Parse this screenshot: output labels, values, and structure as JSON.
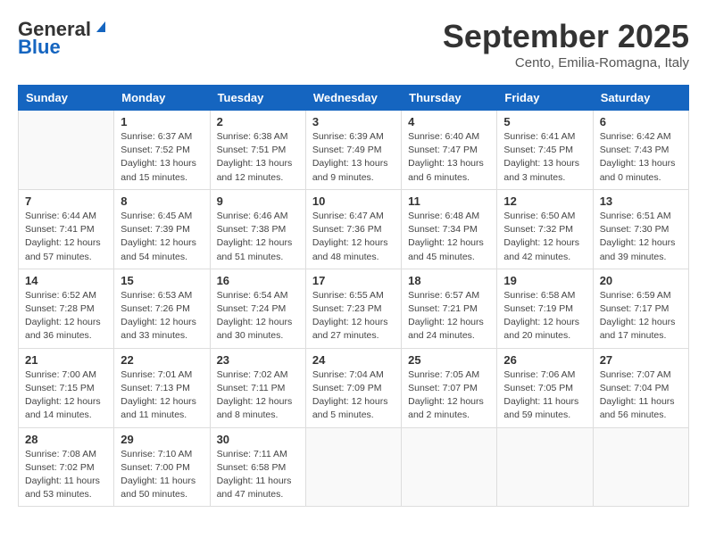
{
  "header": {
    "logo_general": "General",
    "logo_blue": "Blue",
    "month_title": "September 2025",
    "subtitle": "Cento, Emilia-Romagna, Italy"
  },
  "weekdays": [
    "Sunday",
    "Monday",
    "Tuesday",
    "Wednesday",
    "Thursday",
    "Friday",
    "Saturday"
  ],
  "weeks": [
    [
      {
        "day": "",
        "sunrise": "",
        "sunset": "",
        "daylight": ""
      },
      {
        "day": "1",
        "sunrise": "Sunrise: 6:37 AM",
        "sunset": "Sunset: 7:52 PM",
        "daylight": "Daylight: 13 hours and 15 minutes."
      },
      {
        "day": "2",
        "sunrise": "Sunrise: 6:38 AM",
        "sunset": "Sunset: 7:51 PM",
        "daylight": "Daylight: 13 hours and 12 minutes."
      },
      {
        "day": "3",
        "sunrise": "Sunrise: 6:39 AM",
        "sunset": "Sunset: 7:49 PM",
        "daylight": "Daylight: 13 hours and 9 minutes."
      },
      {
        "day": "4",
        "sunrise": "Sunrise: 6:40 AM",
        "sunset": "Sunset: 7:47 PM",
        "daylight": "Daylight: 13 hours and 6 minutes."
      },
      {
        "day": "5",
        "sunrise": "Sunrise: 6:41 AM",
        "sunset": "Sunset: 7:45 PM",
        "daylight": "Daylight: 13 hours and 3 minutes."
      },
      {
        "day": "6",
        "sunrise": "Sunrise: 6:42 AM",
        "sunset": "Sunset: 7:43 PM",
        "daylight": "Daylight: 13 hours and 0 minutes."
      }
    ],
    [
      {
        "day": "7",
        "sunrise": "Sunrise: 6:44 AM",
        "sunset": "Sunset: 7:41 PM",
        "daylight": "Daylight: 12 hours and 57 minutes."
      },
      {
        "day": "8",
        "sunrise": "Sunrise: 6:45 AM",
        "sunset": "Sunset: 7:39 PM",
        "daylight": "Daylight: 12 hours and 54 minutes."
      },
      {
        "day": "9",
        "sunrise": "Sunrise: 6:46 AM",
        "sunset": "Sunset: 7:38 PM",
        "daylight": "Daylight: 12 hours and 51 minutes."
      },
      {
        "day": "10",
        "sunrise": "Sunrise: 6:47 AM",
        "sunset": "Sunset: 7:36 PM",
        "daylight": "Daylight: 12 hours and 48 minutes."
      },
      {
        "day": "11",
        "sunrise": "Sunrise: 6:48 AM",
        "sunset": "Sunset: 7:34 PM",
        "daylight": "Daylight: 12 hours and 45 minutes."
      },
      {
        "day": "12",
        "sunrise": "Sunrise: 6:50 AM",
        "sunset": "Sunset: 7:32 PM",
        "daylight": "Daylight: 12 hours and 42 minutes."
      },
      {
        "day": "13",
        "sunrise": "Sunrise: 6:51 AM",
        "sunset": "Sunset: 7:30 PM",
        "daylight": "Daylight: 12 hours and 39 minutes."
      }
    ],
    [
      {
        "day": "14",
        "sunrise": "Sunrise: 6:52 AM",
        "sunset": "Sunset: 7:28 PM",
        "daylight": "Daylight: 12 hours and 36 minutes."
      },
      {
        "day": "15",
        "sunrise": "Sunrise: 6:53 AM",
        "sunset": "Sunset: 7:26 PM",
        "daylight": "Daylight: 12 hours and 33 minutes."
      },
      {
        "day": "16",
        "sunrise": "Sunrise: 6:54 AM",
        "sunset": "Sunset: 7:24 PM",
        "daylight": "Daylight: 12 hours and 30 minutes."
      },
      {
        "day": "17",
        "sunrise": "Sunrise: 6:55 AM",
        "sunset": "Sunset: 7:23 PM",
        "daylight": "Daylight: 12 hours and 27 minutes."
      },
      {
        "day": "18",
        "sunrise": "Sunrise: 6:57 AM",
        "sunset": "Sunset: 7:21 PM",
        "daylight": "Daylight: 12 hours and 24 minutes."
      },
      {
        "day": "19",
        "sunrise": "Sunrise: 6:58 AM",
        "sunset": "Sunset: 7:19 PM",
        "daylight": "Daylight: 12 hours and 20 minutes."
      },
      {
        "day": "20",
        "sunrise": "Sunrise: 6:59 AM",
        "sunset": "Sunset: 7:17 PM",
        "daylight": "Daylight: 12 hours and 17 minutes."
      }
    ],
    [
      {
        "day": "21",
        "sunrise": "Sunrise: 7:00 AM",
        "sunset": "Sunset: 7:15 PM",
        "daylight": "Daylight: 12 hours and 14 minutes."
      },
      {
        "day": "22",
        "sunrise": "Sunrise: 7:01 AM",
        "sunset": "Sunset: 7:13 PM",
        "daylight": "Daylight: 12 hours and 11 minutes."
      },
      {
        "day": "23",
        "sunrise": "Sunrise: 7:02 AM",
        "sunset": "Sunset: 7:11 PM",
        "daylight": "Daylight: 12 hours and 8 minutes."
      },
      {
        "day": "24",
        "sunrise": "Sunrise: 7:04 AM",
        "sunset": "Sunset: 7:09 PM",
        "daylight": "Daylight: 12 hours and 5 minutes."
      },
      {
        "day": "25",
        "sunrise": "Sunrise: 7:05 AM",
        "sunset": "Sunset: 7:07 PM",
        "daylight": "Daylight: 12 hours and 2 minutes."
      },
      {
        "day": "26",
        "sunrise": "Sunrise: 7:06 AM",
        "sunset": "Sunset: 7:05 PM",
        "daylight": "Daylight: 11 hours and 59 minutes."
      },
      {
        "day": "27",
        "sunrise": "Sunrise: 7:07 AM",
        "sunset": "Sunset: 7:04 PM",
        "daylight": "Daylight: 11 hours and 56 minutes."
      }
    ],
    [
      {
        "day": "28",
        "sunrise": "Sunrise: 7:08 AM",
        "sunset": "Sunset: 7:02 PM",
        "daylight": "Daylight: 11 hours and 53 minutes."
      },
      {
        "day": "29",
        "sunrise": "Sunrise: 7:10 AM",
        "sunset": "Sunset: 7:00 PM",
        "daylight": "Daylight: 11 hours and 50 minutes."
      },
      {
        "day": "30",
        "sunrise": "Sunrise: 7:11 AM",
        "sunset": "Sunset: 6:58 PM",
        "daylight": "Daylight: 11 hours and 47 minutes."
      },
      {
        "day": "",
        "sunrise": "",
        "sunset": "",
        "daylight": ""
      },
      {
        "day": "",
        "sunrise": "",
        "sunset": "",
        "daylight": ""
      },
      {
        "day": "",
        "sunrise": "",
        "sunset": "",
        "daylight": ""
      },
      {
        "day": "",
        "sunrise": "",
        "sunset": "",
        "daylight": ""
      }
    ]
  ]
}
